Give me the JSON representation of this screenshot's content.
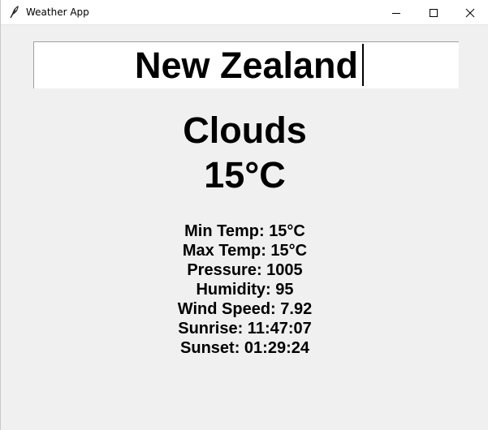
{
  "window": {
    "title": "Weather App",
    "icon": "feather-icon",
    "controls": [
      "minimize-icon",
      "maximize-icon",
      "close-icon"
    ]
  },
  "search": {
    "value": "New Zealand"
  },
  "weather": {
    "condition": "Clouds",
    "temperature": "15°C"
  },
  "details": [
    "Min Temp: 15°C",
    "Max Temp: 15°C",
    "Pressure: 1005",
    "Humidity: 95",
    "Wind Speed: 7.92",
    "Sunrise: 11:47:07",
    "Sunset: 01:29:24"
  ]
}
